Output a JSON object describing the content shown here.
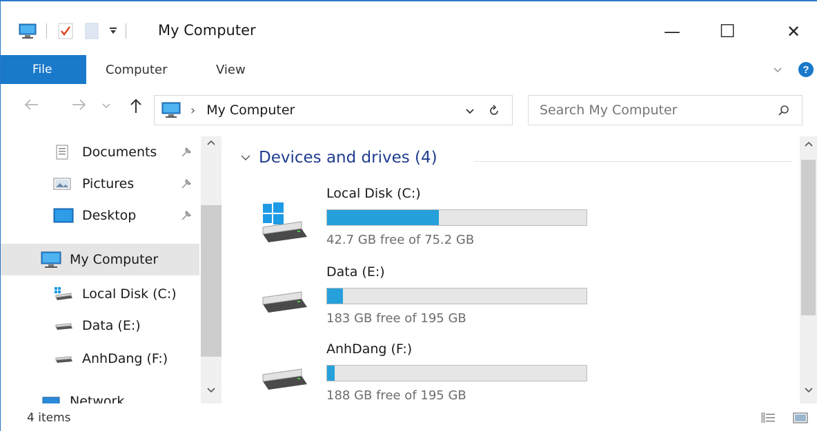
{
  "window": {
    "title": "My Computer",
    "minimize_glyph": "—",
    "maximize_glyph": "☐",
    "close_glyph": "✕"
  },
  "quick_access": {
    "icons": [
      "computer-icon",
      "properties-icon",
      "new-folder-icon",
      "customize-dropdown-icon"
    ]
  },
  "ribbon": {
    "tabs": [
      {
        "label": "File"
      },
      {
        "label": "Computer"
      },
      {
        "label": "View"
      }
    ]
  },
  "address_bar": {
    "separator": "›",
    "path": "My Computer"
  },
  "search": {
    "placeholder": "Search My Computer"
  },
  "nav_pane": {
    "items": [
      {
        "label": "Documents",
        "icon": "documents-icon",
        "pinned": true
      },
      {
        "label": "Pictures",
        "icon": "pictures-icon",
        "pinned": true
      },
      {
        "label": "Desktop",
        "icon": "desktop-icon",
        "pinned": true
      },
      {
        "label": "My Computer",
        "icon": "computer-icon",
        "selected": true
      },
      {
        "label": "Local Disk (C:)",
        "icon": "system-drive-icon"
      },
      {
        "label": "Data (E:)",
        "icon": "drive-icon"
      },
      {
        "label": "AnhDang (F:)",
        "icon": "drive-icon"
      },
      {
        "label": "Network",
        "icon": "network-icon"
      }
    ]
  },
  "content": {
    "group_title": "Devices and drives (4)",
    "drives": [
      {
        "name": "Local Disk (C:)",
        "free": "42.7 GB free of 75.2 GB",
        "used_fraction": 0.43,
        "system": true
      },
      {
        "name": "Data (E:)",
        "free": "183 GB free of 195 GB",
        "used_fraction": 0.06,
        "system": false
      },
      {
        "name": "AnhDang (F:)",
        "free": "188 GB free of 195 GB",
        "used_fraction": 0.03,
        "system": false
      }
    ]
  },
  "status_bar": {
    "item_count": "4 items"
  },
  "colors": {
    "accent": "#1979ca",
    "bar_fill": "#26a0da",
    "group_title": "#1e3d8f",
    "selected_bg": "#e5e5e5"
  }
}
